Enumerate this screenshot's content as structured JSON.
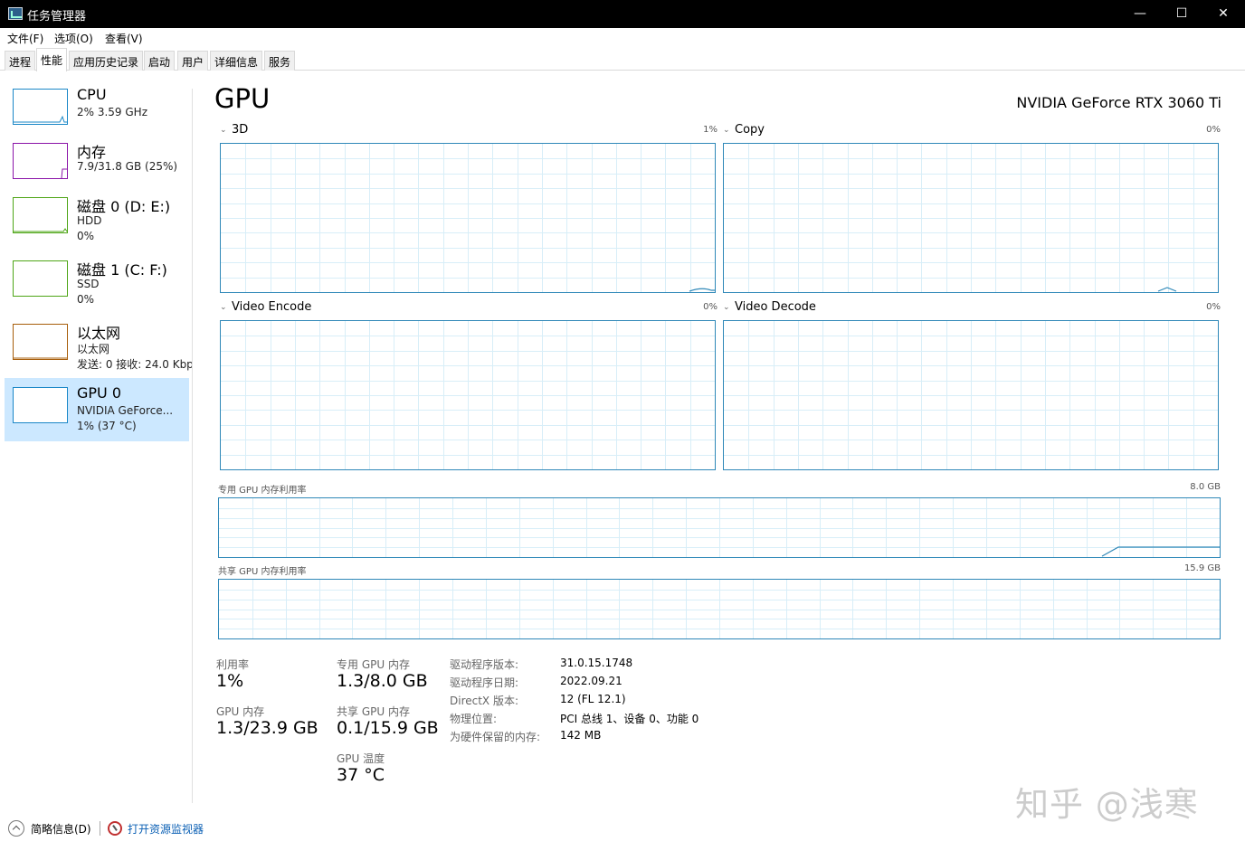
{
  "window": {
    "title": "任务管理器",
    "minimize": "—",
    "maximize": "☐",
    "close": "✕"
  },
  "menu": [
    "文件(F)",
    "选项(O)",
    "查看(V)"
  ],
  "tabs": [
    "进程",
    "性能",
    "应用历史记录",
    "启动",
    "用户",
    "详细信息",
    "服务"
  ],
  "active_tab": "性能",
  "sidebar": {
    "items": [
      {
        "name": "CPU",
        "sub1": "2% 3.59 GHz",
        "sub2": "",
        "sub3": "",
        "color": "#1a87c7"
      },
      {
        "name": "内存",
        "sub1": "7.9/31.8 GB (25%)",
        "sub2": "",
        "sub3": "",
        "color": "#8b14a8"
      },
      {
        "name": "磁盘 0 (D: E:)",
        "sub1": "HDD",
        "sub2": "0%",
        "sub3": "",
        "color": "#4ea516"
      },
      {
        "name": "磁盘 1 (C: F:)",
        "sub1": "SSD",
        "sub2": "0%",
        "sub3": "",
        "color": "#4ea516"
      },
      {
        "name": "以太网",
        "sub1": "以太网",
        "sub2": "发送: 0 接收: 24.0 Kbp",
        "sub3": "",
        "color": "#a75d0a"
      },
      {
        "name": "GPU 0",
        "sub1": "NVIDIA GeForce...",
        "sub2": "1% (37 °C)",
        "sub3": "",
        "color": "#1a87c7"
      }
    ],
    "selected": "GPU 0"
  },
  "main": {
    "title": "GPU",
    "model": "NVIDIA GeForce RTX 3060 Ti",
    "graphs": [
      {
        "label": "3D",
        "value": "1%"
      },
      {
        "label": "Copy",
        "value": "0%"
      },
      {
        "label": "Video Encode",
        "value": "0%"
      },
      {
        "label": "Video Decode",
        "value": "0%"
      }
    ],
    "dedicated_mem_label": "专用 GPU 内存利用率",
    "dedicated_mem_max": "8.0 GB",
    "shared_mem_label": "共享 GPU 内存利用率",
    "shared_mem_max": "15.9 GB",
    "chevron": "⌄"
  },
  "stats": {
    "utilization_label": "利用率",
    "utilization": "1%",
    "gpu_mem_label": "GPU 内存",
    "gpu_mem": "1.3/23.9 GB",
    "dedicated_label": "专用 GPU 内存",
    "dedicated": "1.3/8.0 GB",
    "shared_label": "共享 GPU 内存",
    "shared": "0.1/15.9 GB",
    "temp_label": "GPU 温度",
    "temp": "37 °C"
  },
  "details": [
    {
      "key": "驱动程序版本:",
      "value": "31.0.15.1748"
    },
    {
      "key": "驱动程序日期:",
      "value": "2022.09.21"
    },
    {
      "key": "DirectX 版本:",
      "value": "12 (FL 12.1)"
    },
    {
      "key": "物理位置:",
      "value": "PCI 总线 1、设备 0、功能 0"
    },
    {
      "key": "为硬件保留的内存:",
      "value": "142 MB"
    }
  ],
  "footer": {
    "fewer_details": "简略信息(D)",
    "open_monitor": "打开资源监视器"
  },
  "watermark": "知乎 @浅寒",
  "colors": {
    "accent": "#1a87c7",
    "selected_bg": "#cce8ff",
    "graph_border": "#2f88b8",
    "grid": "#d8eef8"
  }
}
